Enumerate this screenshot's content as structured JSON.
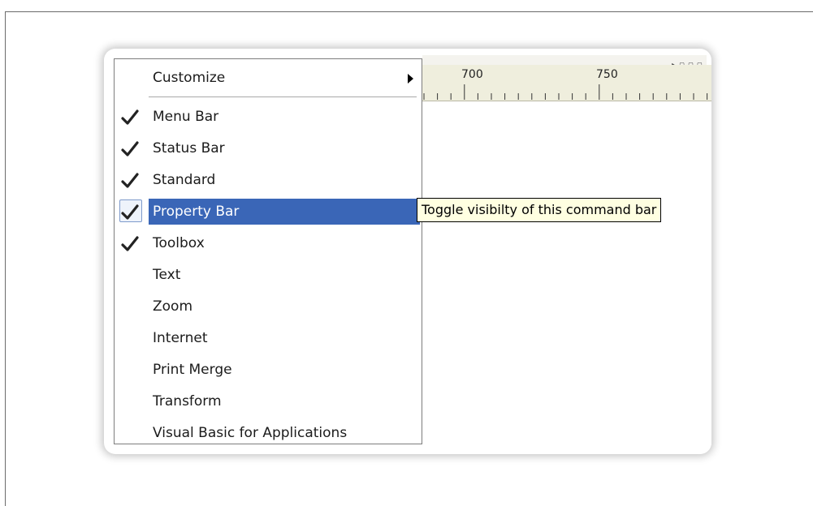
{
  "menu": {
    "customize": {
      "label": "Customize"
    },
    "items": [
      {
        "label": "Menu Bar",
        "checked": true
      },
      {
        "label": "Status Bar",
        "checked": true
      },
      {
        "label": "Standard",
        "checked": true
      },
      {
        "label": "Property Bar",
        "checked": true,
        "selected": true
      },
      {
        "label": "Toolbox",
        "checked": true
      },
      {
        "label": "Text",
        "checked": false
      },
      {
        "label": "Zoom",
        "checked": false
      },
      {
        "label": "Internet",
        "checked": false
      },
      {
        "label": "Print Merge",
        "checked": false
      },
      {
        "label": "Transform",
        "checked": false
      },
      {
        "label": "Visual Basic for Applications",
        "checked": false
      }
    ]
  },
  "tooltip": {
    "text": "Toggle visibilty of this command bar"
  },
  "ruler": {
    "labels": [
      "700",
      "750"
    ]
  },
  "colors": {
    "highlight": "#3a66b7",
    "tooltip_bg": "#ffffe1",
    "ruler_bg": "#efeedd"
  }
}
